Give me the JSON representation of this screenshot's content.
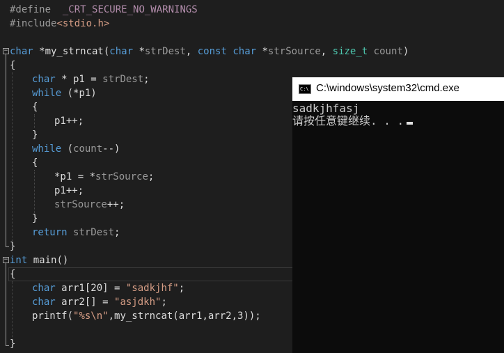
{
  "editor": {
    "lines": {
      "l1": {
        "a": "#define",
        "b": "_CRT_SECURE_NO_WARNINGS"
      },
      "l2": {
        "a": "#include",
        "b": "<stdio.h>"
      },
      "l4": {
        "a": "char",
        "b": " *my_strncat(",
        "c": "char",
        "d": " *",
        "e": "strDest",
        "f": ", ",
        "g": "const",
        "h": " ",
        "i": "char",
        "j": " *",
        "k": "strSource",
        "l": ", ",
        "m": "size_t",
        "n": " ",
        "o": "count",
        "p": ")"
      },
      "l5": "{",
      "l6": {
        "a": "char",
        "b": " * p1 = ",
        "c": "strDest",
        "d": ";"
      },
      "l7": {
        "a": "while",
        "b": " (*p1)"
      },
      "l8": "{",
      "l9": "p1++;",
      "l10": "}",
      "l11": {
        "a": "while",
        "b": " (",
        "c": "count",
        "d": "--)"
      },
      "l12": "{",
      "l13": {
        "a": "*p1 = *",
        "b": "strSource",
        "c": ";"
      },
      "l14": "p1++;",
      "l15": {
        "a": "strSource",
        "b": "++;"
      },
      "l16": "}",
      "l17": {
        "a": "return",
        "b": " ",
        "c": "strDest",
        "d": ";"
      },
      "l18": "}",
      "l19": {
        "a": "int",
        "b": " main()"
      },
      "l20": "{",
      "l21": {
        "a": "char",
        "b": " arr1[20] = ",
        "c": "\"sadkjhf\"",
        "d": ";"
      },
      "l22": {
        "a": "char",
        "b": " arr2[] = ",
        "c": "\"asjdkh\"",
        "d": ";"
      },
      "l23": {
        "a": "printf(",
        "b": "\"%s\\n\"",
        "c": ",my_strncat(arr1,arr2,3));"
      },
      "l25": "}"
    }
  },
  "console": {
    "icon_text": "C:\\",
    "title": "C:\\windows\\system32\\cmd.exe",
    "output": [
      "sadkjhfasj",
      "请按任意键继续. . ."
    ]
  }
}
